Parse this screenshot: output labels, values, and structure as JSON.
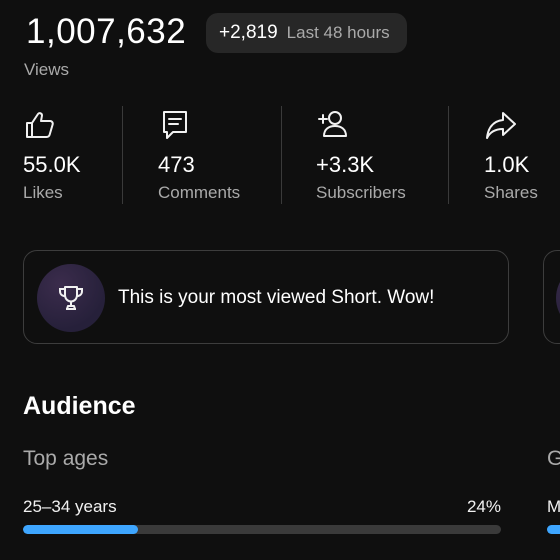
{
  "header": {
    "views_total": "1,007,632",
    "views_delta": "+2,819",
    "views_period": "Last 48 hours",
    "views_label": "Views"
  },
  "stats": [
    {
      "icon": "thumbs-up-icon",
      "value": "55.0K",
      "label": "Likes"
    },
    {
      "icon": "comment-icon",
      "value": "473",
      "label": "Comments"
    },
    {
      "icon": "add-person-icon",
      "value": "+3.3K",
      "label": "Subscribers"
    },
    {
      "icon": "share-icon",
      "value": "1.0K",
      "label": "Shares"
    }
  ],
  "insight": {
    "icon": "trophy-icon",
    "text": "This is your most viewed Short. Wow!"
  },
  "audience": {
    "title": "Audience",
    "top_ages": {
      "title": "Top ages",
      "rows": [
        {
          "label": "25–34 years",
          "percent": "24%",
          "fraction": 0.24
        }
      ]
    },
    "next_card": {
      "title_fragment": "G",
      "row_label_fragment": "M"
    }
  },
  "colors": {
    "background": "#0f0f0f",
    "accent_bar": "#3ea6ff",
    "secondary_text": "#aaaaaa"
  }
}
